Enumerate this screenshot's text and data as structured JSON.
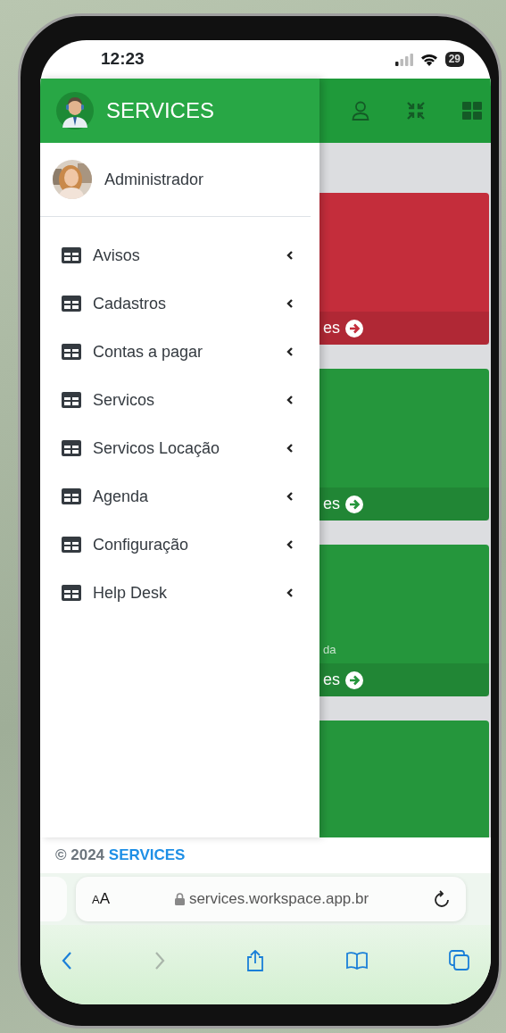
{
  "status_bar": {
    "time": "12:23",
    "battery": "29"
  },
  "drawer": {
    "brand": "SERVICES",
    "user": "Administrador",
    "menu": [
      {
        "label": "Avisos",
        "expanded": false
      },
      {
        "label": "Cadastros",
        "expanded": false
      },
      {
        "label": "Contas a pagar",
        "expanded": false
      },
      {
        "label": "Servicos",
        "expanded": false
      },
      {
        "label": "Servicos Locação",
        "expanded": false
      },
      {
        "label": "Agenda",
        "expanded": false
      },
      {
        "label": "Configuração",
        "expanded": false
      },
      {
        "label": "Help Desk",
        "expanded": false
      }
    ]
  },
  "cards": [
    {
      "color": "#c42d3b",
      "footer": "es"
    },
    {
      "color": "#25963c",
      "footer": "es"
    },
    {
      "color": "#25963c",
      "text": "da",
      "footer": "es"
    },
    {
      "color": "#25963c"
    }
  ],
  "footer": {
    "copyright": "© 2024",
    "brand": "SERVICES"
  },
  "browser": {
    "text_size": "AA",
    "url": "services.workspace.app.br",
    "buttons": [
      {
        "kind": "back",
        "disabled": false
      },
      {
        "kind": "forward",
        "disabled": true
      },
      {
        "kind": "share",
        "disabled": false
      },
      {
        "kind": "bookmarks",
        "disabled": false
      },
      {
        "kind": "tabs",
        "disabled": false
      }
    ]
  }
}
